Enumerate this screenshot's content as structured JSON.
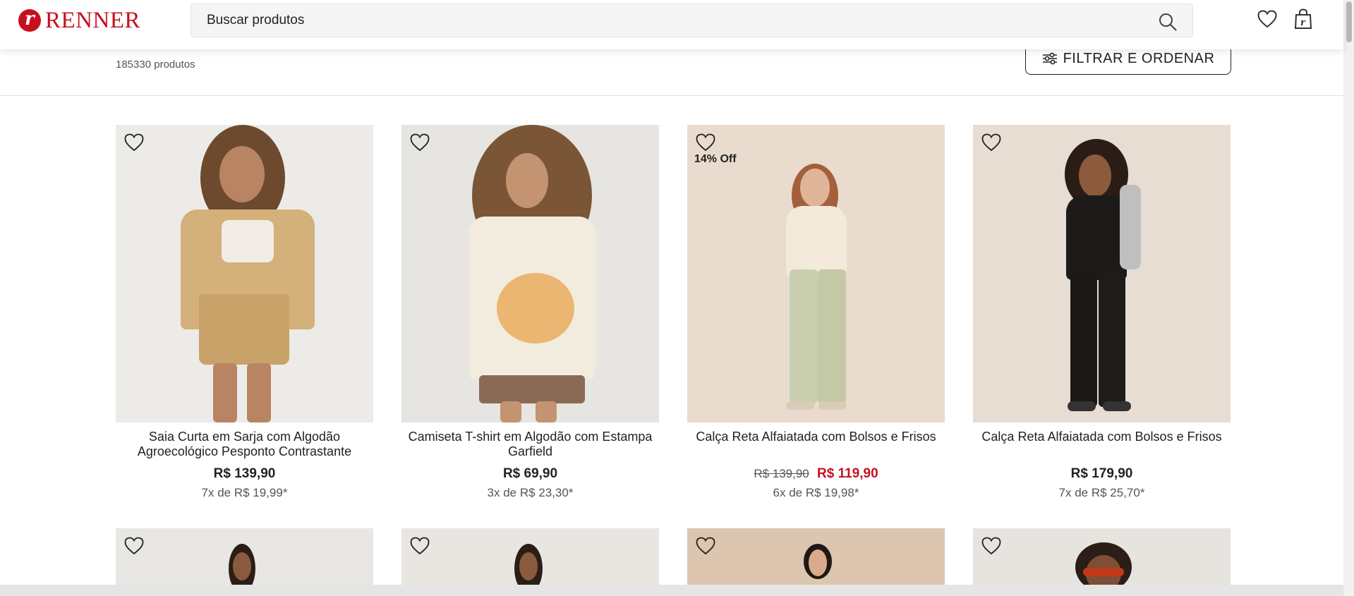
{
  "header": {
    "logo_text": "RENNER",
    "search_placeholder": "Buscar produtos"
  },
  "results": {
    "count_number": "185330",
    "count_label": "produtos",
    "filter_label": "FILTRAR E ORDENAR"
  },
  "products": [
    {
      "name": "Saia Curta em Sarja com Algodão Agroecológico Pesponto Contrastante",
      "price": "R$ 139,90",
      "installments": "7x de R$ 19,99*",
      "badge": "",
      "old_price": "",
      "background": "#ecebe7"
    },
    {
      "name": "Camiseta T-shirt em Algodão com Estampa Garfield",
      "price": "R$ 69,90",
      "installments": "3x de R$ 23,30*",
      "badge": "",
      "old_price": "",
      "background": "#e7e5e1"
    },
    {
      "name": "Calça Reta Alfaiatada com Bolsos e Frisos",
      "price": "R$ 119,90",
      "installments": "6x de R$ 19,98*",
      "badge": "14% Off",
      "old_price": "R$ 139,90",
      "background": "#e9dccf"
    },
    {
      "name": "Calça Reta Alfaiatada com Bolsos e Frisos",
      "price": "R$ 179,90",
      "installments": "7x de R$ 25,70*",
      "badge": "",
      "old_price": "",
      "background": "#e8ddd2"
    }
  ],
  "products_row2": [
    {
      "background": "#e9e7e3"
    },
    {
      "background": "#e9e6e2"
    },
    {
      "background": "#dcc6b0"
    },
    {
      "background": "#e7e4e0"
    }
  ],
  "colors": {
    "brand_red": "#c7101f",
    "sale_red": "#c7101f"
  }
}
